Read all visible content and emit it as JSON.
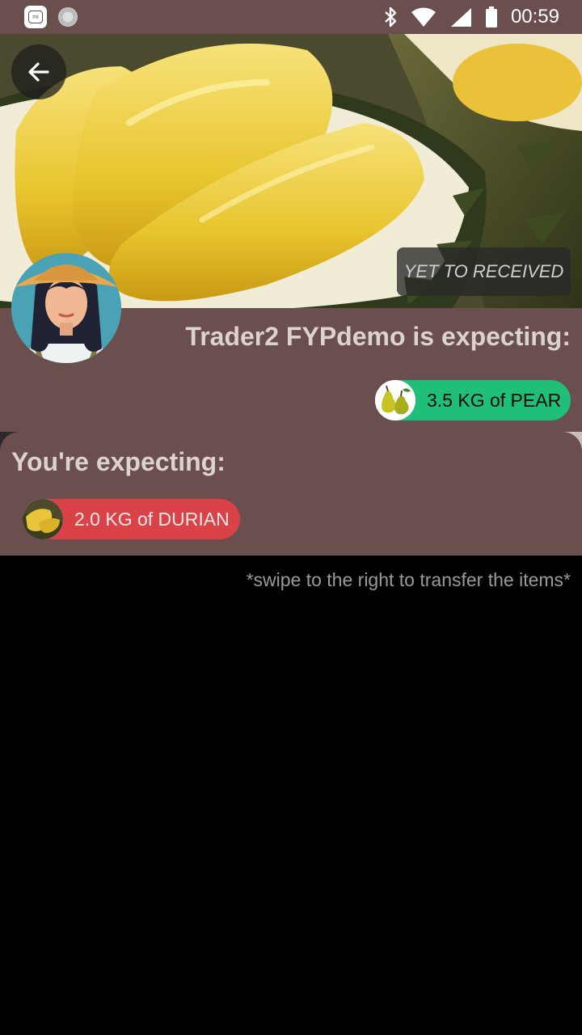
{
  "status_bar": {
    "time": "00:59",
    "icons": [
      "mi-app-icon",
      "notification-dot-icon",
      "bluetooth-icon",
      "wifi-icon",
      "signal-icon",
      "battery-icon"
    ]
  },
  "header": {
    "back_icon": "arrow-left-icon",
    "status_badge": "YET TO RECEIVED"
  },
  "trader": {
    "heading": "Trader2 FYPdemo is expecting:",
    "item_label": "3.5 KG of PEAR",
    "item_icon": "pear-icon",
    "item_color": "#1fbf79"
  },
  "you": {
    "heading": "You're expecting:",
    "item_label": "2.0 KG of DURIAN",
    "item_icon": "durian-icon",
    "item_color": "#d94247"
  },
  "hint": "*swipe to the right to transfer the items*",
  "colors": {
    "panel": "#6a4f4e",
    "background": "#000000"
  }
}
